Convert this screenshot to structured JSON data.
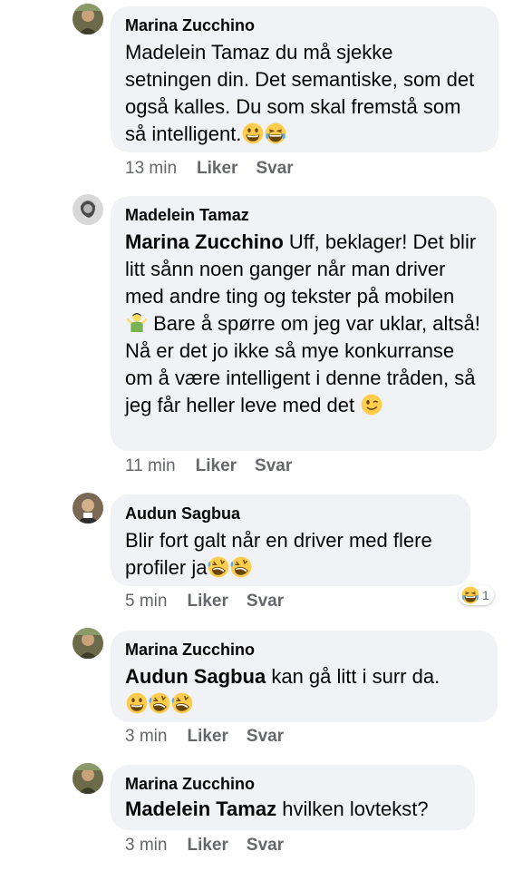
{
  "comments": [
    {
      "author": "Marina Zucchino",
      "mention": "",
      "text": "Madelein Tamaz du må sjekke setningen din. Det semantiske, som det også kalles. Du som skal fremstå som så intelligent.",
      "emojis": [
        "grinning-face",
        "laughing-face"
      ],
      "time": "13 min",
      "like_label": "Liker",
      "reply_label": "Svar"
    },
    {
      "author": "Madelein Tamaz",
      "mention": "Marina Zucchino",
      "text_part1": "Uff, beklager! Det blir litt sånn noen ganger når man driver med andre ting og tekster på mobilen",
      "text_part2": "Bare å spørre om jeg var uklar, altså! Nå er det jo ikke så mye konkurranse om å være intelligent i denne tråden, så jeg får heller leve med det",
      "time": "11 min",
      "like_label": "Liker",
      "reply_label": "Svar"
    },
    {
      "author": "Audun Sagbua",
      "mention": "",
      "text": "Blir fort galt når en driver med flere profiler ja",
      "emojis": [
        "rolling-laughing-face",
        "rolling-laughing-face"
      ],
      "time": "5 min",
      "like_label": "Liker",
      "reply_label": "Svar",
      "reaction_count": "1"
    },
    {
      "author": "Marina Zucchino",
      "mention": "Audun Sagbua",
      "text": "kan gå litt i surr da.",
      "emojis": [
        "grinning-face",
        "rolling-laughing-face",
        "rolling-laughing-face"
      ],
      "time": "3 min",
      "like_label": "Liker",
      "reply_label": "Svar"
    },
    {
      "author": "Marina Zucchino",
      "mention": "Madelein Tamaz",
      "text": "hvilken lovtekst?",
      "time": "3 min",
      "like_label": "Liker",
      "reply_label": "Svar"
    }
  ],
  "colors": {
    "bubble": "#f0f2f5",
    "secondary_text": "#65676b",
    "emoji_yellow": "#ffcc4d"
  }
}
